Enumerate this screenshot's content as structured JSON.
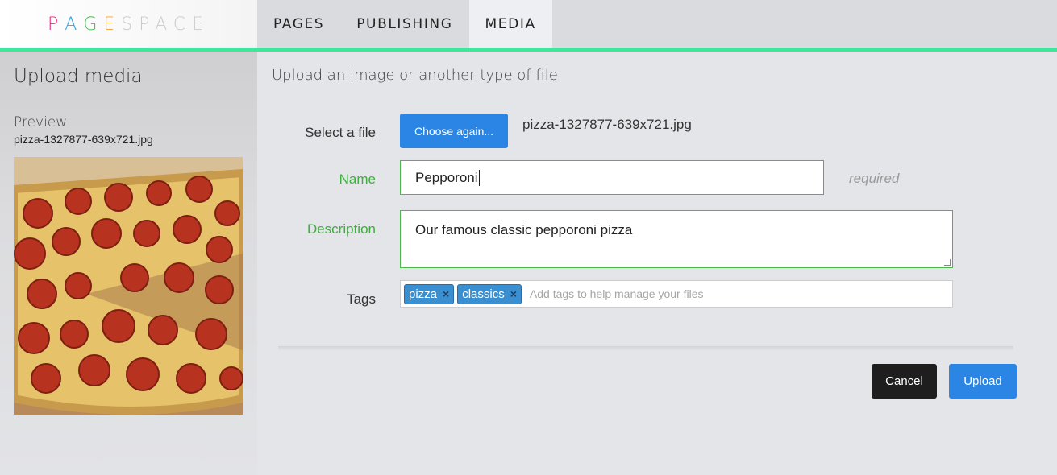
{
  "brand": {
    "logo_letters": [
      "P",
      "A",
      "G",
      "E"
    ],
    "logo_rest": "SPACE",
    "colors": [
      "#e8257a",
      "#2aa7df",
      "#46c04e",
      "#f3a12a"
    ]
  },
  "nav": {
    "items": [
      {
        "label": "PAGES",
        "active": false
      },
      {
        "label": "PUBLISHING",
        "active": false
      },
      {
        "label": "MEDIA",
        "active": true
      }
    ],
    "accent_color": "#3ee89a"
  },
  "sidebar": {
    "title": "Upload media",
    "preview_label": "Preview",
    "filename": "pizza-1327877-639x721.jpg",
    "preview_image": "pepperoni pizza photo"
  },
  "main": {
    "heading": "Upload an image or another type of file",
    "file": {
      "label": "Select a file",
      "button_label": "Choose again...",
      "chosen_filename": "pizza-1327877-639x721.jpg"
    },
    "name": {
      "label": "Name",
      "value": "Pepporoni",
      "hint": "required"
    },
    "description": {
      "label": "Description",
      "value": "Our famous classic pepporoni pizza"
    },
    "tags": {
      "label": "Tags",
      "items": [
        "pizza",
        "classics"
      ],
      "remove_symbol": "×",
      "placeholder": "Add tags to help manage your files"
    }
  },
  "actions": {
    "cancel_label": "Cancel",
    "upload_label": "Upload"
  }
}
